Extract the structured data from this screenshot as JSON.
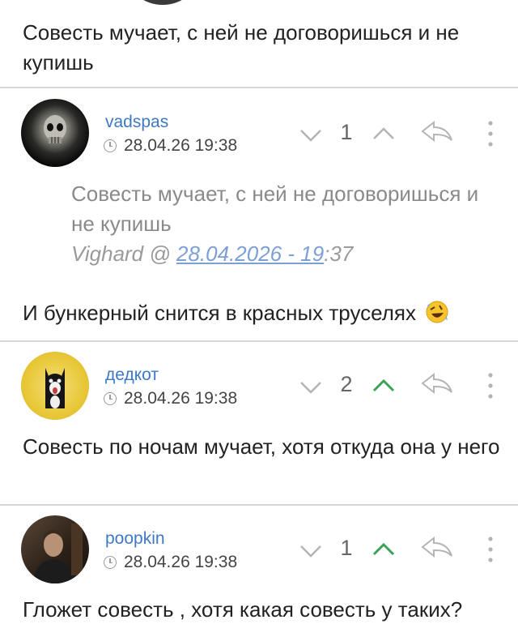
{
  "top_comment": {
    "text": "Совесть мучает, с ней не договоришься и не купишь"
  },
  "comments": [
    {
      "username": "vadspas",
      "timestamp": "28.04.26 19:38",
      "score": "1",
      "upvote_active": false,
      "quote": {
        "text": "Совесть мучает, с ней не договоришься и не купишь",
        "author": "Vighard @ ",
        "link_text": "28.04.2026 - 19",
        "suffix": ":37"
      },
      "text": "И бункерный снится в красных труселях",
      "emoji": "rolling-on-floor-laughing-emoji"
    },
    {
      "username": "дедкот",
      "timestamp": "28.04.26 19:38",
      "score": "2",
      "upvote_active": true,
      "text": "Совесть по ночам мучает, хотя откуда она у него"
    },
    {
      "username": "poopkin",
      "timestamp": "28.04.26 19:38",
      "score": "1",
      "upvote_active": true,
      "text": "Гложет совесть , хотя какая совесть у таких?"
    }
  ],
  "colors": {
    "username": "#3d79c4",
    "upvote_active": "#3aa356",
    "icon_gray": "#b4b4b4",
    "divider": "#d6d6d6"
  },
  "icons": [
    "clock-icon",
    "chevron-down-icon",
    "chevron-up-icon",
    "reply-arrow-icon",
    "more-vertical-icon"
  ]
}
